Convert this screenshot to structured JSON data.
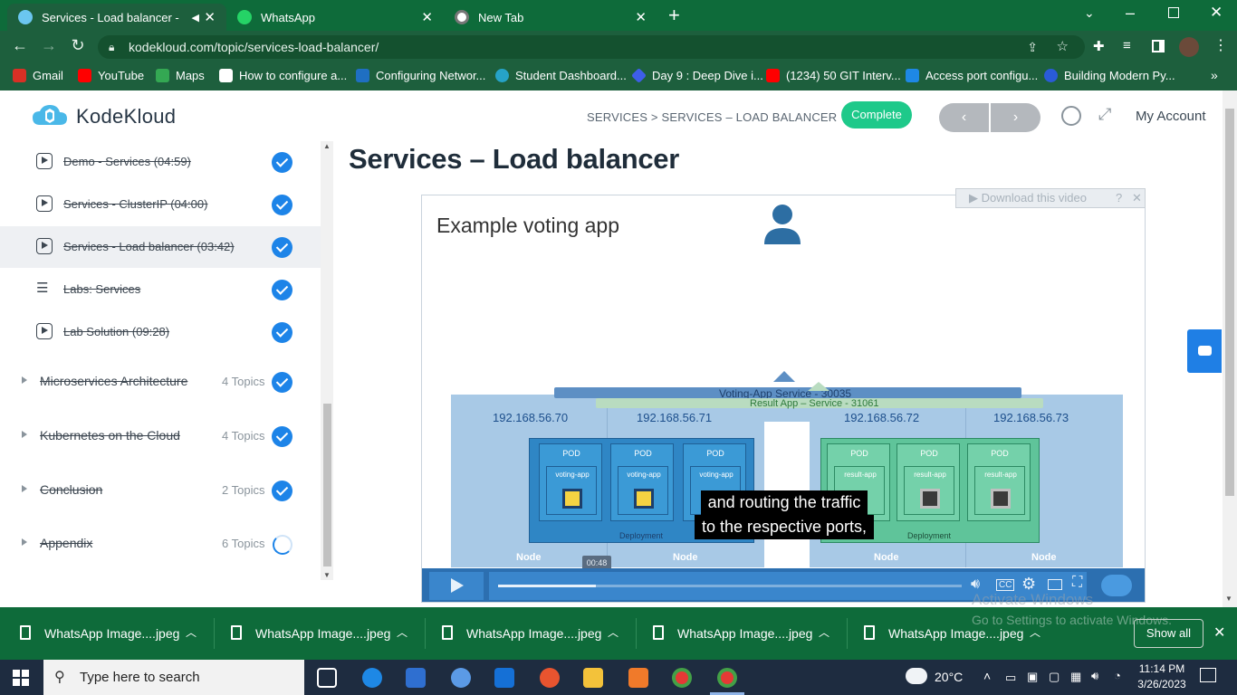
{
  "tabs": [
    {
      "title": "Services - Load balancer - Ko",
      "active": true
    },
    {
      "title": "WhatsApp",
      "active": false
    },
    {
      "title": "New Tab",
      "active": false
    }
  ],
  "address": {
    "url": "kodekloud.com/topic/services-load-balancer/"
  },
  "bookmarks": [
    {
      "label": "Gmail",
      "color": "#d93025"
    },
    {
      "label": "YouTube",
      "color": "#ff0000"
    },
    {
      "label": "Maps",
      "color": "#34a853"
    },
    {
      "label": "How to configure a...",
      "color": "#ffffff"
    },
    {
      "label": "Configuring Networ...",
      "color": "#1f6fc2"
    },
    {
      "label": "Student Dashboard...",
      "color": "#26a3c8"
    },
    {
      "label": "Day 9 : Deep Dive i...",
      "color": "#3e5ee8"
    },
    {
      "label": "(1234) 50 GIT Interv...",
      "color": "#ff0000"
    },
    {
      "label": "Access port configu...",
      "color": "#1e88e5"
    },
    {
      "label": "Building Modern Py...",
      "color": "#2a5bd7"
    }
  ],
  "header": {
    "logo": "KodeKloud",
    "breadcrumb": "SERVICES > SERVICES – LOAD BALANCER",
    "complete_label": "Complete",
    "prev_icon": "‹",
    "next_icon": "›",
    "account_label": "My Account"
  },
  "sidebar": {
    "lessons": [
      {
        "label": "Demo - Services (04:59)",
        "icon": "play-icon",
        "selected": false
      },
      {
        "label": "Services - ClusterIP (04:00)",
        "icon": "play-icon",
        "selected": false
      },
      {
        "label": "Services - Load balancer (03:42)",
        "icon": "play-icon",
        "selected": true
      },
      {
        "label": "Labs: Services",
        "icon": "list-icon",
        "selected": false
      },
      {
        "label": "Lab Solution (09:28)",
        "icon": "play-icon",
        "selected": false
      }
    ],
    "topics": [
      {
        "label": "Microservices Architecture",
        "count": "4 Topics",
        "status": "complete"
      },
      {
        "label": "Kubernetes on the Cloud",
        "count": "4 Topics",
        "status": "complete"
      },
      {
        "label": "Conclusion",
        "count": "2 Topics",
        "status": "complete"
      },
      {
        "label": "Appendix",
        "count": "6 Topics",
        "status": "in-progress"
      }
    ]
  },
  "main": {
    "title": "Services – Load balancer",
    "download_label": "Download this video",
    "video": {
      "slide_title": "Example voting app",
      "voting_service": "Voting-App Service - 30035",
      "result_service": "Result App – Service - 31061",
      "ips": [
        "192.168.56.70",
        "192.168.56.71",
        "192.168.56.72",
        "192.168.56.73"
      ],
      "pod_label": "POD",
      "voting_app": "voting-app",
      "result_app": "result-app",
      "deployment_label": "Deployment",
      "node_label": "Node",
      "caption_line1": "and routing the traffic",
      "caption_line2": "to the respective ports,",
      "time": "00:48",
      "progress": 0.21
    }
  },
  "windows_watermark": {
    "line1": "Activate Windows",
    "line2": "Go to Settings to activate Windows."
  },
  "downloads": {
    "items": [
      "WhatsApp Image....jpeg",
      "WhatsApp Image....jpeg",
      "WhatsApp Image....jpeg",
      "WhatsApp Image....jpeg",
      "WhatsApp Image....jpeg"
    ],
    "show_all": "Show all"
  },
  "taskbar": {
    "search_placeholder": "Type here to search",
    "weather": "20°C",
    "time": "11:14 PM",
    "date": "3/26/2023"
  }
}
